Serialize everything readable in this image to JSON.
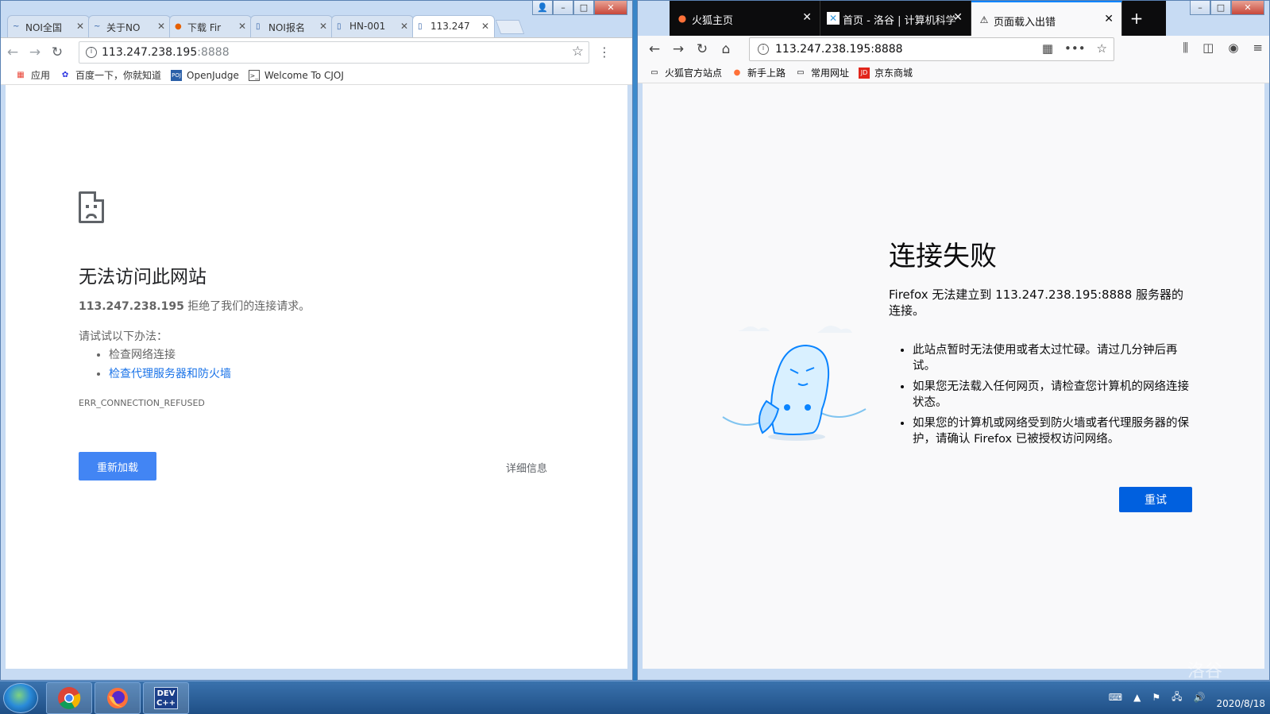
{
  "chrome": {
    "tabs": [
      {
        "label": "NOI全国"
      },
      {
        "label": "关于NO"
      },
      {
        "label": "下载 Fir"
      },
      {
        "label": "NOI报名"
      },
      {
        "label": "HN-001"
      },
      {
        "label": "113.247"
      }
    ],
    "url_host": "113.247.238.195",
    "url_port": ":8888",
    "bookmarks": [
      {
        "label": "应用",
        "icon": "apps-icon"
      },
      {
        "label": "百度一下，你就知道",
        "icon": "baidu-paw-icon"
      },
      {
        "label": "OpenJudge",
        "icon": "openjudge-icon"
      },
      {
        "label": "Welcome To CJOJ",
        "icon": "terminal-icon"
      }
    ],
    "error": {
      "title": "无法访问此网站",
      "host": "113.247.238.195",
      "message": " 拒绝了我们的连接请求。",
      "try_heading": "请试试以下办法：",
      "suggestions": [
        "检查网络连接",
        "检查代理服务器和防火墙"
      ],
      "code": "ERR_CONNECTION_REFUSED",
      "reload_label": "重新加载",
      "details_label": "详细信息"
    }
  },
  "firefox": {
    "tabs": [
      {
        "label": "火狐主页",
        "icon": "firefox-icon"
      },
      {
        "label": "首页 - 洛谷 | 计算机科学",
        "icon": "luogu-icon"
      },
      {
        "label": "页面载入出错",
        "icon": "warning-icon"
      }
    ],
    "url": "113.247.238.195:8888",
    "bookmarks": [
      {
        "label": "火狐官方站点",
        "icon": "folder-icon"
      },
      {
        "label": "新手上路",
        "icon": "firefox-icon"
      },
      {
        "label": "常用网址",
        "icon": "folder-icon"
      },
      {
        "label": "京东商城",
        "icon": "jd-icon"
      }
    ],
    "error": {
      "title": "连接失败",
      "description": "Firefox 无法建立到 113.247.238.195:8888 服务器的连接。",
      "items": [
        "此站点暂时无法使用或者太过忙碌。请过几分钟后再试。",
        "如果您无法载入任何网页，请检查您计算机的网络连接状态。",
        "如果您的计算机或网络受到防火墙或者代理服务器的保护，请确认 Firefox 已被授权访问网络。"
      ],
      "retry_label": "重试"
    }
  },
  "taskbar": {
    "apps": [
      "chrome",
      "firefox",
      "dev-cpp"
    ],
    "date": "2020/8/18",
    "watermark": "洛谷"
  }
}
